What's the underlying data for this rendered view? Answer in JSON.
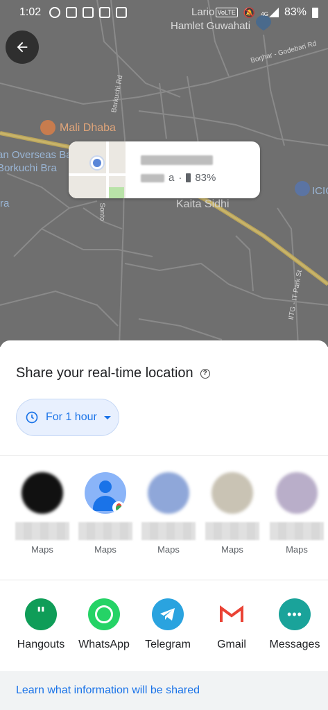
{
  "status_bar": {
    "time": "1:02",
    "volte": "VoLTE",
    "network": "4G",
    "battery": "83%"
  },
  "map": {
    "places": {
      "dhaba": "Mali Dhaba",
      "overseas_line1": "an Overseas Ba",
      "overseas_line2": "Borkuchi Bra",
      "kaita": "Kaita Sidhi",
      "lario_line1": "Lario",
      "lario_line2": "Hamlet Guwahati",
      "icic": "ICIC",
      "ra": "ra"
    },
    "roads": {
      "barkuchi": "Barkuchi Rd",
      "borjhar": "Borjhar - Godebari Rd",
      "sonto": "Sonto",
      "iitg": "IITG - IT Park St"
    }
  },
  "location_card": {
    "sub_text": "a",
    "battery": "83%"
  },
  "sheet": {
    "title": "Share your real-time location",
    "duration": "For 1 hour",
    "contacts": [
      {
        "app": "Maps",
        "color": "#111111"
      },
      {
        "app": "Maps",
        "color": "#4285f4"
      },
      {
        "app": "Maps",
        "color": "#8fa7d9"
      },
      {
        "app": "Maps",
        "color": "#c9c3b4"
      },
      {
        "app": "Maps",
        "color": "#b9aec9"
      }
    ],
    "apps": [
      {
        "label": "Hangouts",
        "color": "#0f9d58",
        "icon": "hangouts-icon"
      },
      {
        "label": "WhatsApp",
        "color": "#25d366",
        "icon": "whatsapp-icon"
      },
      {
        "label": "Telegram",
        "color": "#2aa3df",
        "icon": "telegram-icon"
      },
      {
        "label": "Gmail",
        "color": "#ffffff",
        "icon": "gmail-icon"
      },
      {
        "label": "Messages",
        "color": "#1aa39a",
        "icon": "messages-icon"
      }
    ],
    "learn_link": "Learn what information will be shared"
  }
}
